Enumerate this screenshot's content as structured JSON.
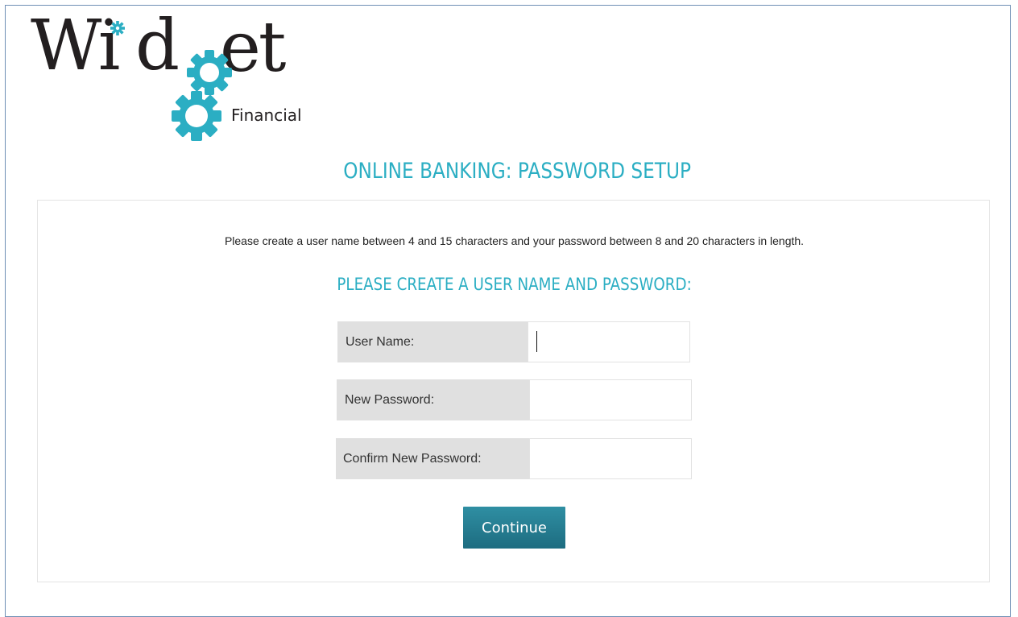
{
  "brand": {
    "logo_word_left": "Wi",
    "logo_word_d": "d",
    "logo_word_right": "et",
    "logo_sub": "Financial",
    "accent_color": "#2baec3",
    "text_color": "#231f20"
  },
  "header": {
    "title": "ONLINE BANKING: PASSWORD SETUP"
  },
  "form": {
    "instructions": "Please create a user name between 4 and 15 characters and your password between 8 and 20 characters in length.",
    "section_title": "PLEASE CREATE A USER NAME AND PASSWORD:",
    "fields": [
      {
        "label": "User Name:",
        "value": "",
        "focused": true
      },
      {
        "label": "New Password:",
        "value": ""
      },
      {
        "label": "Confirm New Password:",
        "value": ""
      }
    ],
    "submit_label": "Continue",
    "button_color": "#25798d"
  }
}
